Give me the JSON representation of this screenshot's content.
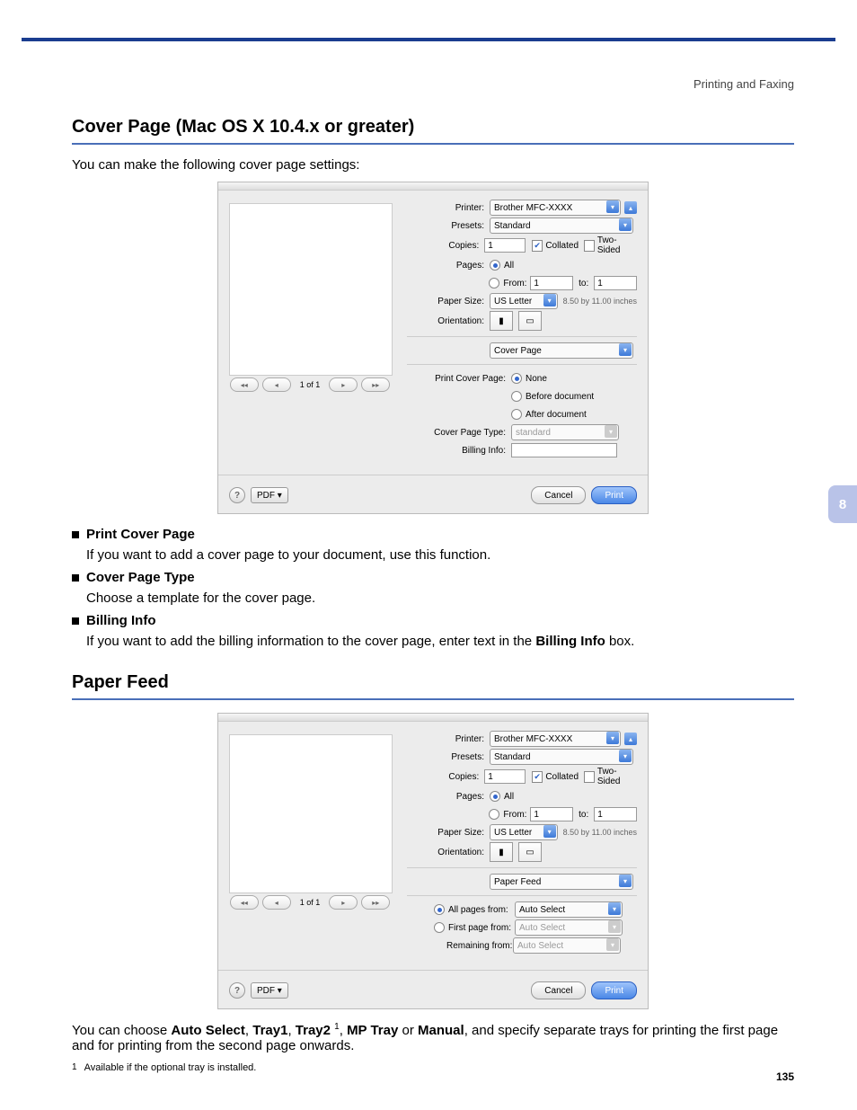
{
  "header": {
    "right": "Printing and Faxing"
  },
  "sidetab": "8",
  "pagenum": "135",
  "section1": {
    "title": "Cover Page (Mac OS X 10.4.x or greater)",
    "intro": "You can make the following cover page settings:",
    "bullets": [
      {
        "label": "Print Cover Page",
        "text": "If you want to add a cover page to your document, use this function."
      },
      {
        "label": "Cover Page Type",
        "text": "Choose a template for the cover page."
      },
      {
        "label": "Billing Info",
        "text_pre": "If you want to add the billing information to the cover page, enter text in the ",
        "bold": "Billing Info",
        "text_post": " box."
      }
    ]
  },
  "section2": {
    "title": "Paper Feed",
    "text_pre": "You can choose ",
    "opts": [
      "Auto Select",
      "Tray1",
      "Tray2",
      "MP Tray",
      "Manual"
    ],
    "text_post": ", and specify separate trays for printing the first page and for printing from the second page onwards.",
    "footnote_marker": "1",
    "footnote": "Available if the optional tray is installed."
  },
  "dialog_common": {
    "printer_label": "Printer:",
    "printer_value": "Brother MFC-XXXX",
    "presets_label": "Presets:",
    "presets_value": "Standard",
    "copies_label": "Copies:",
    "copies_value": "1",
    "collated": "Collated",
    "twosided": "Two-Sided",
    "pages_label": "Pages:",
    "pages_all": "All",
    "pages_from": "From:",
    "pages_from_val": "1",
    "pages_to": "to:",
    "pages_to_val": "1",
    "papersize_label": "Paper Size:",
    "papersize_value": "US Letter",
    "papersize_dim": "8.50 by 11.00 inches",
    "orientation_label": "Orientation:",
    "pager_text": "1 of 1",
    "help": "?",
    "pdf": "PDF ▾",
    "cancel": "Cancel",
    "print": "Print"
  },
  "dialog1": {
    "section_value": "Cover Page",
    "pcp_label": "Print Cover Page:",
    "pcp_none": "None",
    "pcp_before": "Before document",
    "pcp_after": "After document",
    "cpt_label": "Cover Page Type:",
    "cpt_value": "standard",
    "billing_label": "Billing Info:"
  },
  "dialog2": {
    "section_value": "Paper Feed",
    "all_pages": "All pages from:",
    "first_page": "First page from:",
    "remaining": "Remaining from:",
    "auto": "Auto Select"
  }
}
